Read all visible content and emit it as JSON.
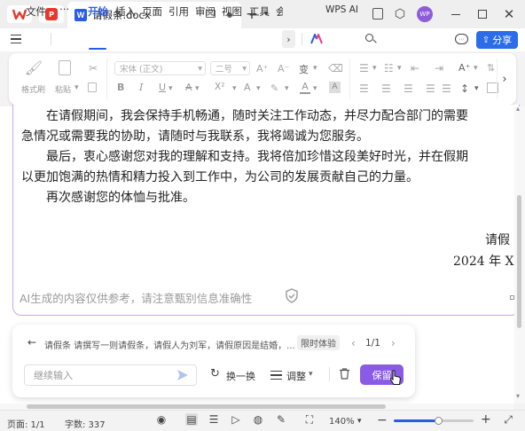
{
  "app": {
    "doc_tab_title": "请假条.docx",
    "user_initials": "WP"
  },
  "menu": {
    "file": "文件",
    "more": "⋯",
    "tabs": [
      "开始",
      "插入",
      "页面",
      "引用",
      "审阅",
      "视图",
      "工具",
      "会"
    ],
    "wps_ai": "WPS AI",
    "share": "分享"
  },
  "ribbon": {
    "format_painter": "格式刷",
    "paste": "粘贴",
    "font_name": "宋体 (正文)",
    "font_size": "二号",
    "bold": "B",
    "italic": "I",
    "underline": "U",
    "strike": "A",
    "superscript": "X²",
    "phonetic": "变"
  },
  "document": {
    "lines": [
      "在请假期间，我会保持手机畅通，随时关注工作动态，并尽力配合部门的需要",
      "急情况或需要我的协助，请随时与我联系，我将竭诚为您服务。",
      "最后，衷心感谢您对我的理解和支持。我将倍加珍惜这段美好时光，并在假期",
      "以更加饱满的热情和精力投入到工作中，为公司的发展贡献自己的力量。",
      "再次感谢您的体恤与批准。"
    ],
    "signature": "请假",
    "date": "2024 年 X"
  },
  "ai": {
    "disclaimer": "AI生成的内容仅供参考，请注意甄别信息准确性",
    "prompt": "请假条 请撰写一则请假条，请假人为刘军，请假原因是结婚，...",
    "badge": "限时体验",
    "page": "1/1",
    "continue_placeholder": "继续输入",
    "swap": "换一换",
    "adjust": "调整",
    "keep": "保留"
  },
  "status": {
    "page": "页面: 1/1",
    "words": "字数: 337",
    "zoom": "140%",
    "zoom_level": 0.55
  },
  "colors": {
    "accent": "#2b5ce6",
    "ai_purple": "#8a5ce6",
    "ai_border": "#c8a6f0"
  }
}
